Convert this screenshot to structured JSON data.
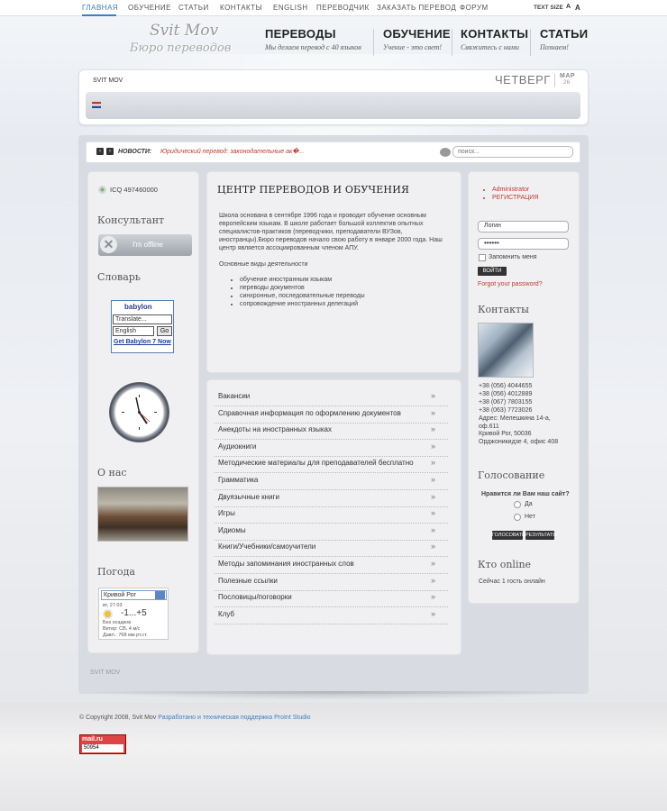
{
  "nav": {
    "items": [
      "ГЛАВНАЯ",
      "ОБУЧЕНИЕ",
      "СТАТЬИ",
      "КОНТАКТЫ",
      "ENGLISH",
      "ПЕРЕВОДЧИК",
      "ЗАКАЗАТЬ ПЕРЕВОД",
      "ФОРУМ"
    ],
    "active_index": 0,
    "text_size_label": "TEXT SIZE"
  },
  "logo": {
    "line1": "Svit Mov",
    "line2": "Бюро переводов"
  },
  "header_menu": [
    {
      "title": "ПЕРЕВОДЫ",
      "subtitle": "Мы делаем перевод с 40 языков"
    },
    {
      "title": "ОБУЧЕНИЕ",
      "subtitle": "Учение - это свет!"
    },
    {
      "title": "КОНТАКТЫ",
      "subtitle": "Свяжитесь с нами"
    },
    {
      "title": "СТАТЬИ",
      "subtitle": "Познаем!"
    }
  ],
  "topbox": {
    "site_name": "SVIT MOV",
    "day_name": "ЧЕТВЕРГ",
    "month": "МАР",
    "day_number": "26"
  },
  "news": {
    "label": "НОВОСТИ:",
    "text": "Юридический перевод: законодательные ак�...",
    "search_placeholder": "поиск..."
  },
  "left": {
    "icq": "ICQ 497460000",
    "consultant_heading": "Консультант",
    "offline_label": "I'm offline",
    "dictionary_heading": "Словарь",
    "babylon": {
      "brand": "babylon",
      "input_value": "Translate...",
      "select_value": "English",
      "go_label": "Go",
      "link_text": "Get Babylon 7 Now"
    },
    "about_heading": "О нас",
    "weather_heading": "Погода",
    "weather": {
      "city": "Кривой Рог",
      "date": "вт, 27.03",
      "temp": "-1...+5",
      "line1": "Без осадков",
      "line2": "Ветер: СВ, 4 м/с",
      "line3": "Давл.: 768 мм рт.ст."
    }
  },
  "center": {
    "title": "ЦЕНТР ПЕРЕВОДОВ И ОБУЧЕНИЯ",
    "paragraph": "Школа основана в сентябре 1996 года и проводит обучение основным европейским языкам. В школе работает большой коллектив опытных специалистов-практиков (переводчики, преподаватели ВУЗов, иностранцы).Бюро переводов начало свою работу в январе 2000 года. Наш центр является ассоциированным членом АПУ.",
    "activities_heading": "Основные виды деятельности",
    "activities": [
      "обучение иностранным языкам",
      "переводы документов",
      "синхронные, последовательные переводы",
      "сопровождение иностранных делегаций"
    ]
  },
  "menu_items": [
    "Вакансии",
    "Справочная информация по оформлению документов",
    "Анекдоты на иностранных языках",
    "Аудиокниги",
    "Методические материалы для преподавателей бесплатно",
    "Грамматика",
    "Двуязычные книги",
    "Игры",
    "Идиомы",
    "Книги/Учебники/самоучители",
    "Методы запоминания иностранных слов",
    "Полезные ссылки",
    "Пословицы/поговорки",
    "Клуб"
  ],
  "menu_arrow": "»",
  "right": {
    "links": [
      "Administrator",
      "РЕГИСТРАЦИЯ"
    ],
    "login_value": "Логин",
    "password_value": "••••••",
    "remember_label": "Запомнить меня",
    "login_button": "ВОЙТИ",
    "forgot_link": "Forgot your password?",
    "contacts_heading": "Контакты",
    "contacts_lines": [
      "+38 (056) 4044655",
      "+38 (056) 4012889",
      "+38 (067) 7803155",
      "+38 (063) 7723026",
      "Адрес: Мелешкина 14-а,",
      "оф.611",
      "Кривой Рог, 50036",
      "Орджоникидзе 4, офис 408"
    ],
    "poll_heading": "Голосование",
    "poll_question": "Нравится ли Вам наш сайт?",
    "poll_options": [
      "Да",
      "Нет"
    ],
    "vote_button": "ГОЛОСОВАТЬ",
    "results_button": "РЕЗУЛЬТАТЫ",
    "online_heading": "Кто online",
    "online_text": "Сейчас 1 гость онлайн"
  },
  "footer": {
    "site_name": "SVIT MOV",
    "copyright": "© Copyright 2008, Svit Mov",
    "dev_link": "Разработано и техническая поддержка ProInt Studio",
    "counter_brand": "mail.ru",
    "counter_value": "50954"
  },
  "colors": {
    "accent": "#3c7fc0",
    "link_red": "#c0392b"
  }
}
